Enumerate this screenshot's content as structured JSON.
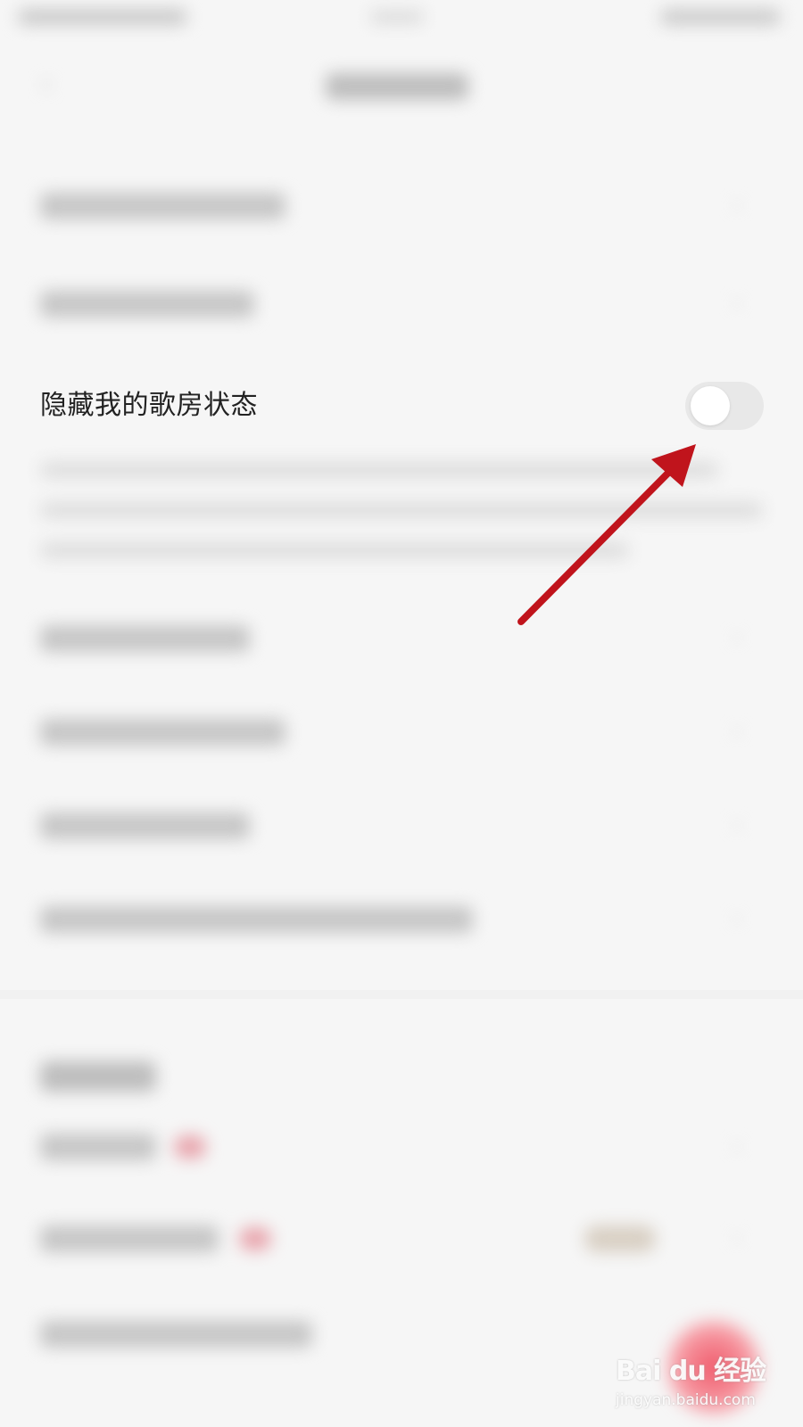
{
  "settings": {
    "hide_karaoke_status_label": "隐藏我的歌房状态",
    "hide_karaoke_status_enabled": false
  },
  "watermark": {
    "brand": "Bai du 经验",
    "url": "jingyan.baidu.com"
  },
  "colors": {
    "annotation_arrow": "#c0141c",
    "toggle_off_track": "#e8e8e8",
    "toggle_knob": "#ffffff",
    "text_primary": "#222222",
    "background": "#f6f6f6"
  },
  "icons": {
    "back": "back-arrow-icon",
    "row_chevron": "chevron-right-icon",
    "annotation": "red-arrow-pointer-icon"
  }
}
